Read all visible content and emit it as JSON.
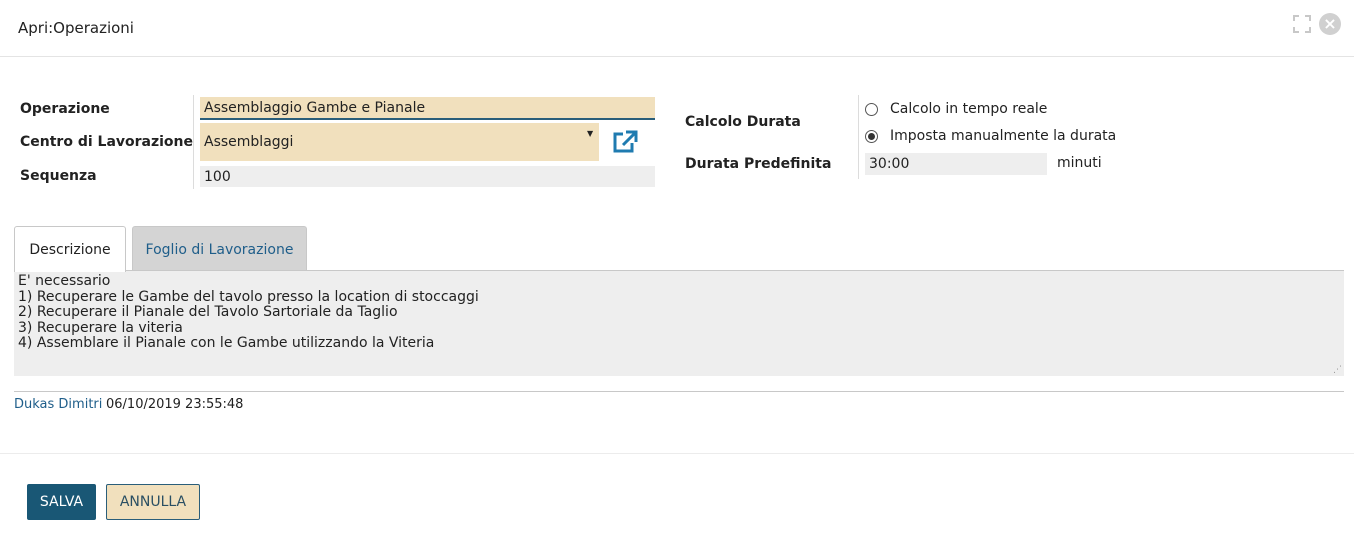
{
  "window": {
    "title": "Apri:Operazioni",
    "expand_icon": "expand-icon",
    "close_icon": "close-icon"
  },
  "form": {
    "operazione": {
      "label": "Operazione",
      "value": "Assemblaggio Gambe e Pianale"
    },
    "centro": {
      "label": "Centro di Lavorazione",
      "value": "Assemblaggi",
      "link_icon": "external-link-icon"
    },
    "sequenza": {
      "label": "Sequenza",
      "value": "100"
    },
    "calcolo": {
      "label": "Calcolo Durata",
      "options": [
        {
          "label": "Calcolo in tempo reale",
          "checked": false
        },
        {
          "label": "Imposta manualmente la durata",
          "checked": true
        }
      ]
    },
    "durata": {
      "label": "Durata Predefinita",
      "value": "30:00",
      "unit": "minuti"
    }
  },
  "tabs": [
    {
      "label": "Descrizione",
      "active": true
    },
    {
      "label": "Foglio di Lavorazione",
      "active": false
    }
  ],
  "description": {
    "lines": [
      "E' necessario",
      "1) Recuperare le Gambe del tavolo presso la location di stoccaggi",
      "2) Recuperare il Pianale del Tavolo Sartoriale da Taglio",
      "3) Recuperare la viteria",
      "4) Assemblare il Pianale con le Gambe utilizzando la Viteria"
    ]
  },
  "audit": {
    "user": "Dukas Dimitri",
    "timestamp": "06/10/2019 23:55:48"
  },
  "buttons": {
    "save": "SALVA",
    "cancel": "ANNULLA"
  },
  "colors": {
    "accent": "#195775",
    "field_bg": "#f1e0bd",
    "link": "#1f5e8a"
  }
}
